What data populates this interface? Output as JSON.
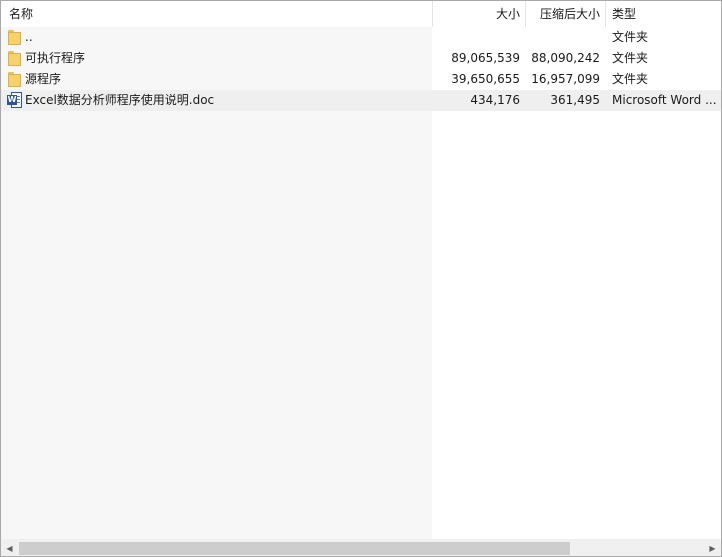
{
  "columns": {
    "name": "名称",
    "size": "大小",
    "packed": "压缩后大小",
    "type": "类型",
    "sort_arrow": "^"
  },
  "rows": [
    {
      "name": "..",
      "size": "",
      "packed": "",
      "type": "文件夹",
      "icon": "folder-icon"
    },
    {
      "name": "可执行程序",
      "size": "89,065,539",
      "packed": "88,090,242",
      "type": "文件夹",
      "icon": "folder-icon"
    },
    {
      "name": "源程序",
      "size": "39,650,655",
      "packed": "16,957,099",
      "type": "文件夹",
      "icon": "folder-icon"
    },
    {
      "name": "Excel数据分析师程序使用说明.doc",
      "size": "434,176",
      "packed": "361,495",
      "type": "Microsoft Word ...",
      "icon": "word-doc-icon"
    }
  ],
  "colors": {
    "folder": "#f6d26b",
    "word": "#2b579a",
    "selected_row": "#efefef"
  }
}
